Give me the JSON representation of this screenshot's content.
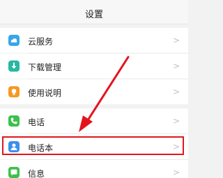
{
  "header": {
    "title": "设置"
  },
  "settings": {
    "items": [
      {
        "label": "云服务",
        "icon": "cloud-icon"
      },
      {
        "label": "下载管理",
        "icon": "download-icon"
      },
      {
        "label": "使用说明",
        "icon": "lightbulb-icon"
      },
      {
        "label": "电话",
        "icon": "phone-icon"
      },
      {
        "label": "电话本",
        "icon": "contacts-icon"
      },
      {
        "label": "信息",
        "icon": "message-icon"
      }
    ],
    "chevron": ">"
  },
  "annotation": {
    "highlight_color": "#e3141e",
    "highlighted_item": "电话本"
  },
  "colors": {
    "cloud": "#37a6e9",
    "download": "#26b9a2",
    "lightbulb": "#f49a23",
    "phone": "#3cc14c",
    "contacts": "#3b8ff0",
    "message": "#3cc14c"
  }
}
